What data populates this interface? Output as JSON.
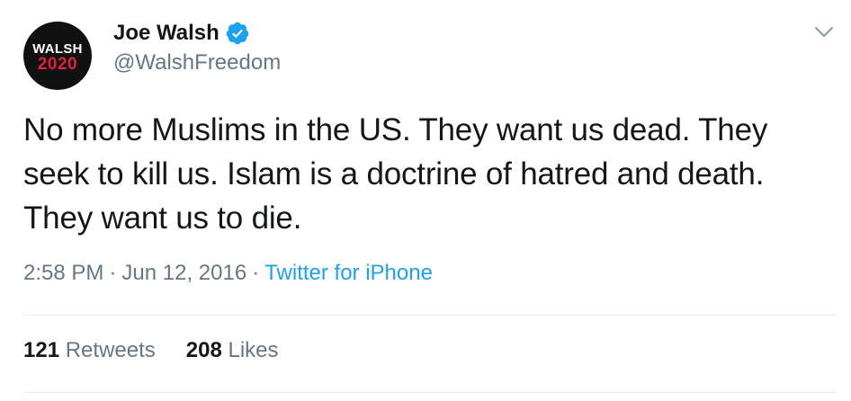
{
  "author": {
    "avatar_line1": "WALSH",
    "avatar_line2": "2020",
    "display_name": "Joe Walsh",
    "handle": "@WalshFreedom",
    "verified": true
  },
  "tweet": {
    "text": "No more Muslims in the US. They want us dead. They seek to kill us. Islam is a doctrine of hatred and death. They want us to die.",
    "time": "2:58 PM",
    "separator": "·",
    "date": "Jun 12, 2016",
    "source": "Twitter for iPhone"
  },
  "stats": {
    "retweets_count": "121",
    "retweets_label": "Retweets",
    "likes_count": "208",
    "likes_label": "Likes"
  },
  "icons": {
    "verified": "verified-badge-icon",
    "menu": "chevron-down-icon"
  },
  "colors": {
    "accent": "#1da1f2",
    "text": "#14171a",
    "muted": "#657786",
    "divider": "#e6ecf0",
    "avatar_bg": "#111111",
    "avatar_red": "#e0213b"
  }
}
